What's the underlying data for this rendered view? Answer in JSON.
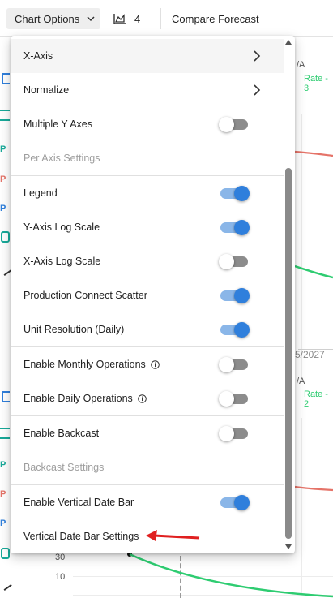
{
  "toolbar": {
    "chart_options_label": "Chart Options",
    "series_count": "4",
    "compare_label": "Compare Forecast"
  },
  "background": {
    "na_top": "/A",
    "rate_top": "Rate - 3",
    "date_tick": "5/2027",
    "na_bottom": "/A",
    "rate_bottom": "Rate - 2",
    "y_tick_30": "30",
    "y_tick_10": "10",
    "side_p": "P",
    "colors": {
      "green": "#2ecc71",
      "red": "#e57368",
      "blue": "#2f7fdc",
      "teal": "#18a999"
    }
  },
  "menu": {
    "items": [
      {
        "label": "X-Axis",
        "type": "submenu"
      },
      {
        "label": "Normalize",
        "type": "submenu"
      },
      {
        "label": "Multiple Y Axes",
        "type": "toggle",
        "on": false
      },
      {
        "label": "Per Axis Settings",
        "type": "disabled"
      },
      {
        "label": "Legend",
        "type": "toggle",
        "on": true
      },
      {
        "label": "Y-Axis Log Scale",
        "type": "toggle",
        "on": true
      },
      {
        "label": "X-Axis Log Scale",
        "type": "toggle",
        "on": false
      },
      {
        "label": "Production Connect Scatter",
        "type": "toggle",
        "on": true
      },
      {
        "label": "Unit Resolution (Daily)",
        "type": "toggle",
        "on": true
      },
      {
        "label": "Enable Monthly Operations",
        "type": "toggle",
        "on": false,
        "info": true
      },
      {
        "label": "Enable Daily Operations",
        "type": "toggle",
        "on": false,
        "info": true
      },
      {
        "label": "Enable Backcast",
        "type": "toggle",
        "on": false
      },
      {
        "label": "Backcast Settings",
        "type": "disabled"
      },
      {
        "label": "Enable Vertical Date Bar",
        "type": "toggle",
        "on": true
      },
      {
        "label": "Vertical Date Bar Settings",
        "type": "item"
      }
    ]
  },
  "annotation_color": "#e02020"
}
